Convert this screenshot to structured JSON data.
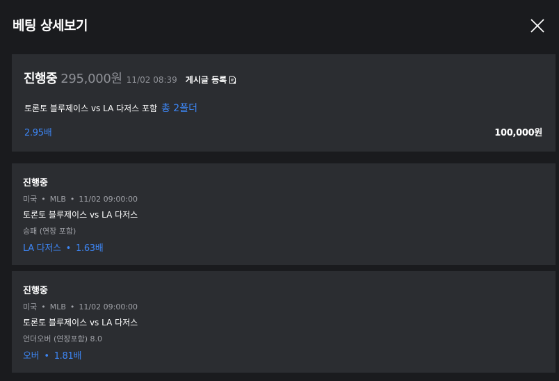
{
  "modal": {
    "title": "베팅 상세보기",
    "close_icon": "close-icon"
  },
  "summary": {
    "status": "진행중",
    "amount": "295,000원",
    "datetime": "11/02 08:39",
    "post_label": "게시글 등록",
    "post_icon": "edit-document-icon",
    "match_text": "토론토 블루제이스 vs LA 다저스 포함",
    "folder_text": "총 2폴더",
    "odds": "2.95배",
    "stake": "100,000원"
  },
  "bets": [
    {
      "status": "진행중",
      "country": "미국",
      "league": "MLB",
      "datetime": "11/02 09:00:00",
      "match": "토론토 블루제이스 vs LA 다저스",
      "market": "승패 (연장 포함)",
      "pick": "LA 다저스",
      "odds": "1.63배"
    },
    {
      "status": "진행중",
      "country": "미국",
      "league": "MLB",
      "datetime": "11/02 09:00:00",
      "match": "토론토 블루제이스 vs LA 다저스",
      "market": "언더오버 (연장포함) 8.0",
      "pick": "오버",
      "odds": "1.81배"
    }
  ],
  "separator": "•",
  "colors": {
    "background": "#1a1b1e",
    "card": "#2b2d31",
    "accent": "#3d86f5",
    "muted_text": "#a0a2a8",
    "text": "#ffffff"
  }
}
